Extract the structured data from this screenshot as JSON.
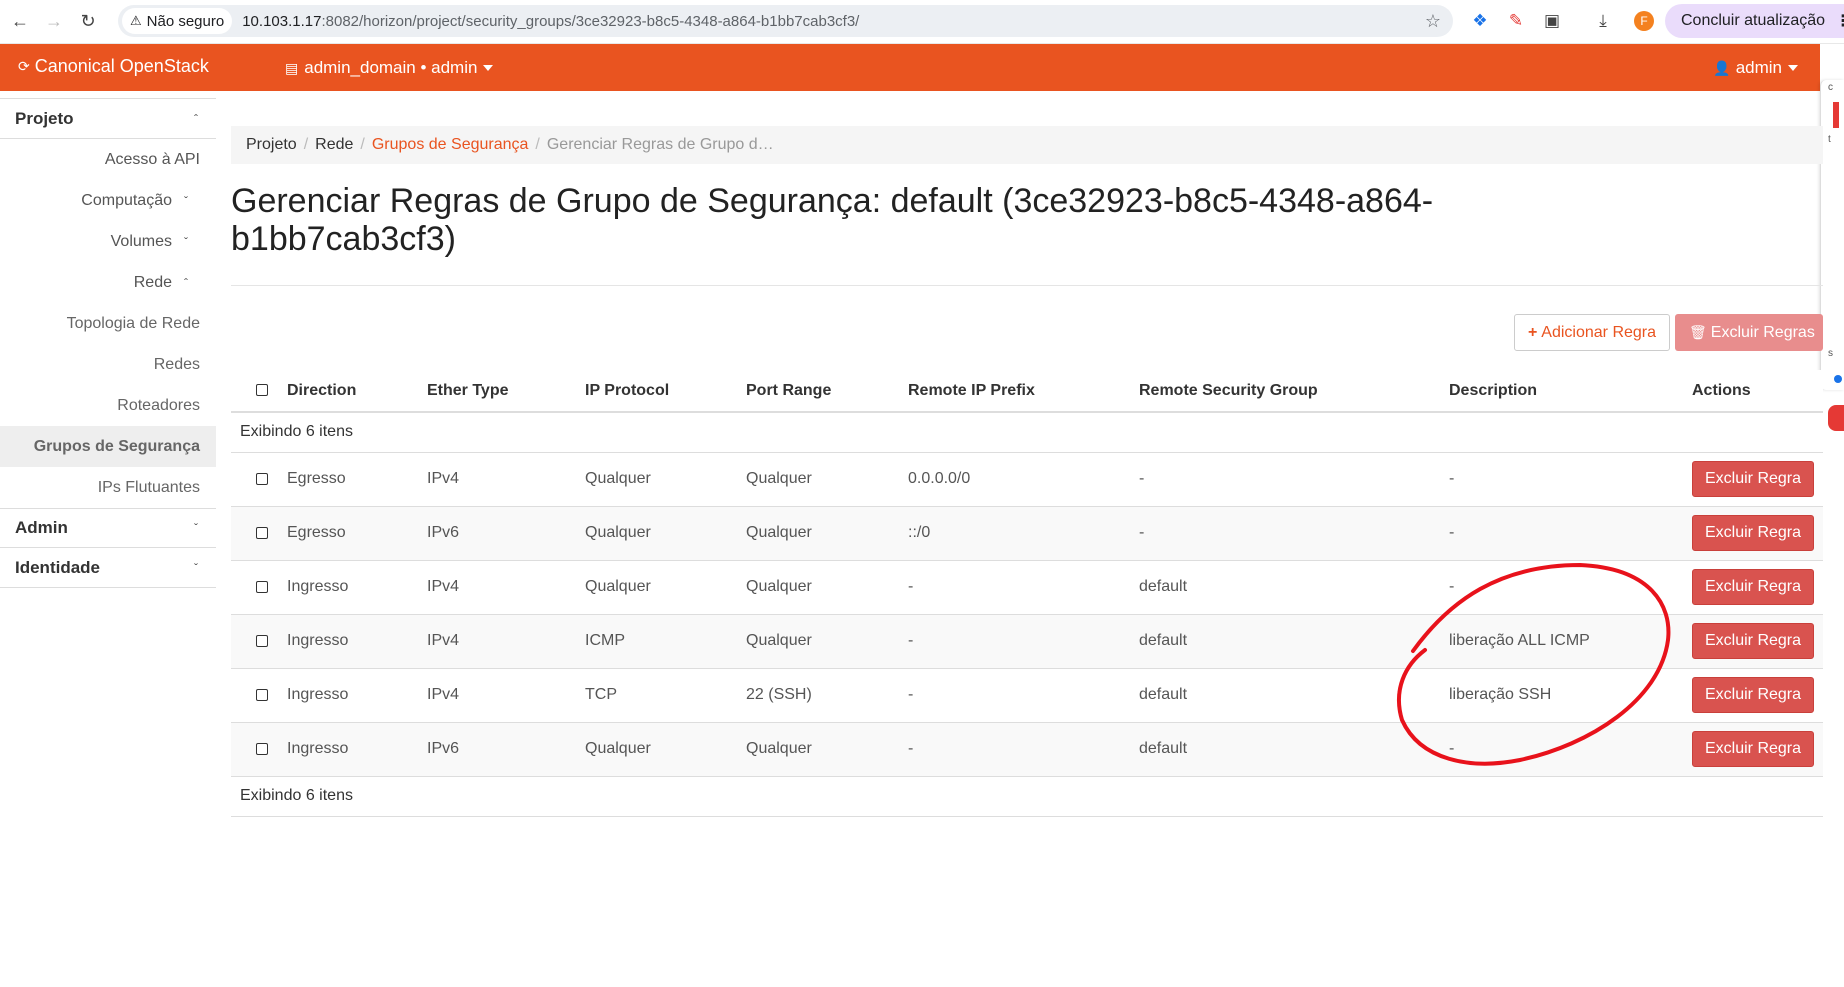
{
  "browser": {
    "insecure_label": "Não seguro",
    "url_host": "10.103.1.17",
    "url_path": ":8082/horizon/project/security_groups/3ce32923-b8c5-4348-a864-b1bb7cab3cf3/",
    "profile_initial": "F",
    "update_label": "Concluir atualização"
  },
  "navbar": {
    "brand": "Canonical OpenStack",
    "project_selector": "admin_domain • admin",
    "user": "admin",
    "accent_color": "#e95420"
  },
  "sidebar": {
    "project_label": "Projeto",
    "items": [
      {
        "label": "Acesso à API"
      },
      {
        "label": "Computação"
      },
      {
        "label": "Volumes"
      },
      {
        "label": "Rede"
      },
      {
        "label": "Topologia de Rede"
      },
      {
        "label": "Redes"
      },
      {
        "label": "Roteadores"
      },
      {
        "label": "Grupos de Segurança"
      },
      {
        "label": "IPs Flutuantes"
      }
    ],
    "admin_label": "Admin",
    "identity_label": "Identidade"
  },
  "breadcrumb": {
    "project": "Projeto",
    "network": "Rede",
    "security_groups": "Grupos de Segurança",
    "current": "Gerenciar Regras de Grupo d…"
  },
  "page": {
    "title_line1": "Gerenciar Regras de Grupo de Segurança: default (3ce32923-b8c5-4348-a864-",
    "title_line2": "b1bb7cab3cf3)",
    "add_rule": "Adicionar Regra",
    "delete_rules": "Excluir Regras",
    "item_count": "Exibindo 6 itens"
  },
  "table": {
    "columns": [
      "Direction",
      "Ether Type",
      "IP Protocol",
      "Port Range",
      "Remote IP Prefix",
      "Remote Security Group",
      "Description",
      "Actions"
    ],
    "rows": [
      {
        "direction": "Egresso",
        "ether": "IPv4",
        "protocol": "Qualquer",
        "port": "Qualquer",
        "prefix": "0.0.0.0/0",
        "group": "-",
        "description": "-",
        "action": "Excluir Regra"
      },
      {
        "direction": "Egresso",
        "ether": "IPv6",
        "protocol": "Qualquer",
        "port": "Qualquer",
        "prefix": "::/0",
        "group": "-",
        "description": "-",
        "action": "Excluir Regra"
      },
      {
        "direction": "Ingresso",
        "ether": "IPv4",
        "protocol": "Qualquer",
        "port": "Qualquer",
        "prefix": "-",
        "group": "default",
        "description": "-",
        "action": "Excluir Regra"
      },
      {
        "direction": "Ingresso",
        "ether": "IPv4",
        "protocol": "ICMP",
        "port": "Qualquer",
        "prefix": "-",
        "group": "default",
        "description": "liberação ALL ICMP",
        "action": "Excluir Regra"
      },
      {
        "direction": "Ingresso",
        "ether": "IPv4",
        "protocol": "TCP",
        "port": "22 (SSH)",
        "prefix": "-",
        "group": "default",
        "description": "liberação SSH",
        "action": "Excluir Regra"
      },
      {
        "direction": "Ingresso",
        "ether": "IPv6",
        "protocol": "Qualquer",
        "port": "Qualquer",
        "prefix": "-",
        "group": "default",
        "description": "-",
        "action": "Excluir Regra"
      }
    ]
  },
  "annotation": {
    "color": "#e8121b",
    "shape": "hand-drawn-ellipse"
  }
}
